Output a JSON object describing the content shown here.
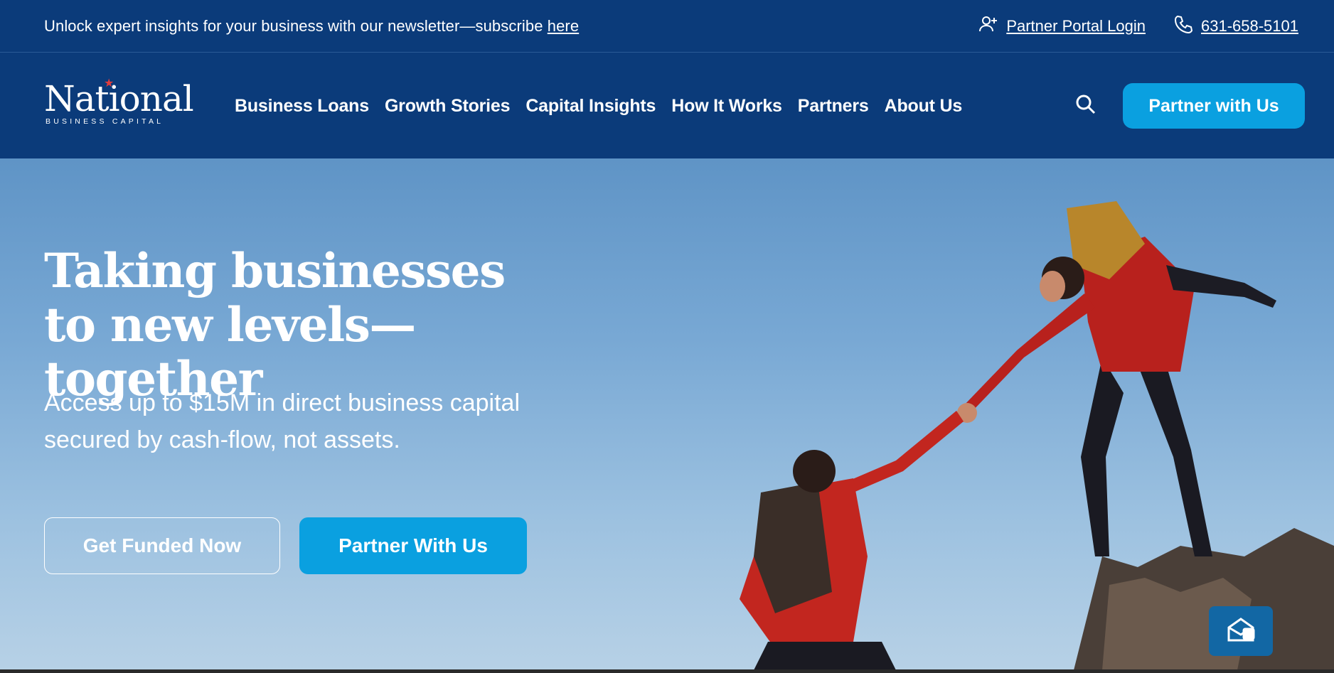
{
  "topbar": {
    "promo_text": "Unlock expert insights for your business with our newsletter—subscribe ",
    "promo_link": "here",
    "portal_login": "Partner Portal Login",
    "phone": "631-658-5101"
  },
  "nav": {
    "logo_word": "National",
    "logo_sub": "BUSINESS CAPITAL",
    "items": [
      {
        "label": "Business Loans"
      },
      {
        "label": "Growth Stories"
      },
      {
        "label": "Capital Insights"
      },
      {
        "label": "How It Works"
      },
      {
        "label": "Partners"
      },
      {
        "label": "About Us"
      }
    ],
    "cta": "Partner with Us"
  },
  "hero": {
    "headline": "Taking businesses to new levels—together",
    "subhead": "Access up to $15M in direct business capital secured by cash-flow, not assets.",
    "btn_primary": "Get Funded Now",
    "btn_secondary": "Partner With Us"
  },
  "colors": {
    "brand_navy": "#0b3b7a",
    "accent_blue": "#0aa0e0",
    "chat_blue": "#1267a4"
  },
  "icons": {
    "portal": "user-plus-icon",
    "phone": "phone-icon",
    "search": "search-icon",
    "chat": "mail-chat-icon"
  }
}
